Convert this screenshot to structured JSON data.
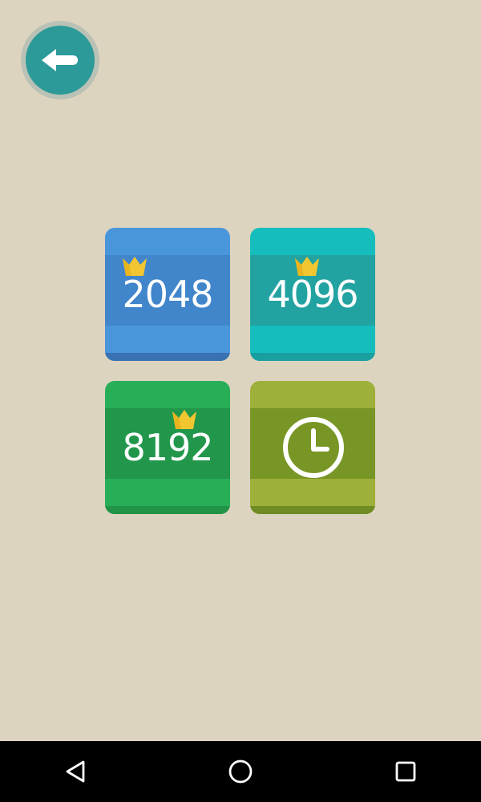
{
  "tiles": [
    {
      "label": "2048",
      "has_crown": true,
      "icon": "crown-icon",
      "colors": {
        "main": "#4a96db",
        "band": "#4185cb",
        "bottom": "#3872b3"
      }
    },
    {
      "label": "4096",
      "has_crown": true,
      "icon": "crown-icon",
      "colors": {
        "main": "#16bdbd",
        "band": "#22a3a1",
        "bottom": "#189f9e"
      }
    },
    {
      "label": "8192",
      "has_crown": true,
      "icon": "crown-icon",
      "colors": {
        "main": "#27ae57",
        "band": "#22974b",
        "bottom": "#209346"
      }
    },
    {
      "label": "",
      "icon": "clock-icon",
      "colors": {
        "main": "#9db03a",
        "band": "#789625",
        "bottom": "#6f8b23"
      }
    }
  ],
  "back_button": {
    "icon": "back-arrow-icon",
    "color": "#2c9a99"
  },
  "navbar": {
    "buttons": [
      {
        "icon": "back-triangle-icon"
      },
      {
        "icon": "home-circle-icon"
      },
      {
        "icon": "recents-square-icon"
      }
    ]
  },
  "colors": {
    "background": "#ddd4c0",
    "crown": "#f2c630"
  }
}
